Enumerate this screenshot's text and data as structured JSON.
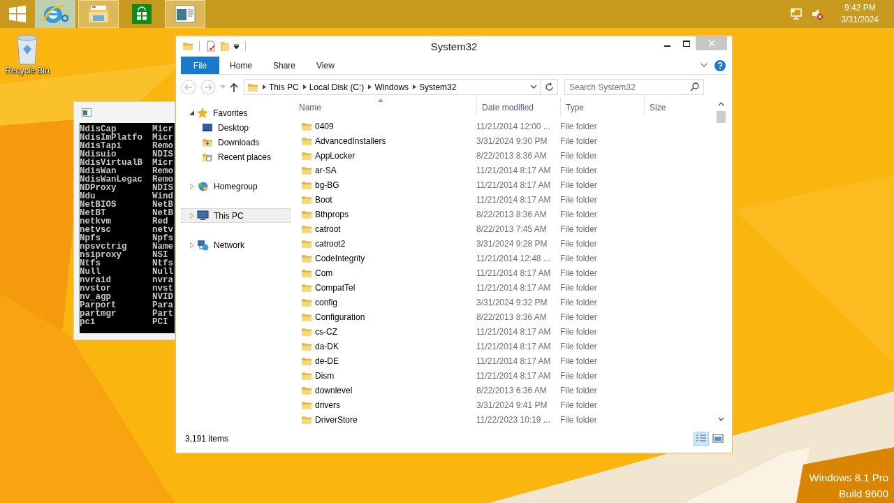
{
  "taskbar": {
    "apps": [
      {
        "kind": "browser",
        "running": false,
        "hovered": true
      },
      {
        "kind": "explorer",
        "running": true,
        "hovered": false
      },
      {
        "kind": "store",
        "running": false,
        "hovered": false
      },
      {
        "kind": "console",
        "running": true,
        "hovered": false
      }
    ],
    "clock": {
      "time": "9:42 PM",
      "date": "3/31/2024"
    }
  },
  "desktop": {
    "icons": [
      {
        "label": "Recycle Bin"
      }
    ],
    "edition": "Windows 8.1 Pro",
    "build": "Build 9600"
  },
  "console": {
    "lines": [
      {
        "col_1": "NdisCap",
        "col_2": "Micr"
      },
      {
        "col_1": "NdisImPlatfo",
        "col_2": "Micr"
      },
      {
        "col_1": "NdisTapi",
        "col_2": "Remo"
      },
      {
        "col_1": "Ndisuio",
        "col_2": "NDIS"
      },
      {
        "col_1": "NdisVirtualB",
        "col_2": "Micr"
      },
      {
        "col_1": "NdisWan",
        "col_2": "Remo"
      },
      {
        "col_1": "NdisWanLegac",
        "col_2": "Remo"
      },
      {
        "col_1": "NDProxy",
        "col_2": "NDIS"
      },
      {
        "col_1": "Ndu",
        "col_2": "Wind"
      },
      {
        "col_1": "NetBIOS",
        "col_2": "NetB"
      },
      {
        "col_1": "NetBT",
        "col_2": "NetB"
      },
      {
        "col_1": "netkvm",
        "col_2": "Red"
      },
      {
        "col_1": "netvsc",
        "col_2": "netv"
      },
      {
        "col_1": "Npfs",
        "col_2": "Npfs"
      },
      {
        "col_1": "npsvctrig",
        "col_2": "Name"
      },
      {
        "col_1": "nsiproxy",
        "col_2": "NSI"
      },
      {
        "col_1": "Ntfs",
        "col_2": "Ntfs"
      },
      {
        "col_1": "Null",
        "col_2": "Null"
      },
      {
        "col_1": "nvraid",
        "col_2": "nvra"
      },
      {
        "col_1": "nvstor",
        "col_2": "nvst"
      },
      {
        "col_1": "nv_agp",
        "col_2": "NVID"
      },
      {
        "col_1": "Parport",
        "col_2": "Para"
      },
      {
        "col_1": "partmgr",
        "col_2": "Part"
      },
      {
        "col_1": "pci",
        "col_2": "PCI"
      }
    ]
  },
  "explorer": {
    "title": "System32",
    "ribbon_tabs": [
      {
        "label": "File",
        "kind": "file"
      },
      {
        "label": "Home",
        "kind": "tab"
      },
      {
        "label": "Share",
        "kind": "tab"
      },
      {
        "label": "View",
        "kind": "tab"
      }
    ],
    "breadcrumb": [
      "This PC",
      "Local Disk (C:)",
      "Windows",
      "System32"
    ],
    "search": {
      "placeholder": "Search System32"
    },
    "nav": [
      {
        "label": "Favorites",
        "kind": "favorites",
        "expanded": true,
        "selected": false,
        "children": [
          {
            "label": "Desktop",
            "kind": "desktop",
            "selected": false
          },
          {
            "label": "Downloads",
            "kind": "downloads",
            "selected": false
          },
          {
            "label": "Recent places",
            "kind": "recent",
            "selected": false
          }
        ]
      },
      {
        "label": "Homegroup",
        "kind": "homegroup",
        "expanded": false,
        "selected": false
      },
      {
        "label": "This PC",
        "kind": "pc",
        "expanded": false,
        "selected": true
      },
      {
        "label": "Network",
        "kind": "network",
        "expanded": false,
        "selected": false
      }
    ],
    "columns": [
      {
        "label": "Name",
        "sorted": true
      },
      {
        "label": "Date modified",
        "sorted": false
      },
      {
        "label": "Type",
        "sorted": false
      },
      {
        "label": "Size",
        "sorted": false
      }
    ],
    "rows": [
      {
        "name": "0409",
        "date": "11/21/2014 12:00 ...",
        "type": "File folder"
      },
      {
        "name": "AdvancedInstallers",
        "date": "3/31/2024 9:30 PM",
        "type": "File folder"
      },
      {
        "name": "AppLocker",
        "date": "8/22/2013 8:36 AM",
        "type": "File folder"
      },
      {
        "name": "ar-SA",
        "date": "11/21/2014 8:17 AM",
        "type": "File folder"
      },
      {
        "name": "bg-BG",
        "date": "11/21/2014 8:17 AM",
        "type": "File folder"
      },
      {
        "name": "Boot",
        "date": "11/21/2014 8:17 AM",
        "type": "File folder"
      },
      {
        "name": "Bthprops",
        "date": "8/22/2013 8:36 AM",
        "type": "File folder"
      },
      {
        "name": "catroot",
        "date": "8/22/2013 7:45 AM",
        "type": "File folder"
      },
      {
        "name": "catroot2",
        "date": "3/31/2024 9:28 PM",
        "type": "File folder"
      },
      {
        "name": "CodeIntegrity",
        "date": "11/21/2014 12:48 ...",
        "type": "File folder"
      },
      {
        "name": "Com",
        "date": "11/21/2014 8:17 AM",
        "type": "File folder"
      },
      {
        "name": "CompatTel",
        "date": "11/21/2014 8:17 AM",
        "type": "File folder"
      },
      {
        "name": "config",
        "date": "3/31/2024 9:32 PM",
        "type": "File folder"
      },
      {
        "name": "Configuration",
        "date": "8/22/2013 8:36 AM",
        "type": "File folder"
      },
      {
        "name": "cs-CZ",
        "date": "11/21/2014 8:17 AM",
        "type": "File folder"
      },
      {
        "name": "da-DK",
        "date": "11/21/2014 8:17 AM",
        "type": "File folder"
      },
      {
        "name": "de-DE",
        "date": "11/21/2014 8:17 AM",
        "type": "File folder"
      },
      {
        "name": "Dism",
        "date": "11/21/2014 8:17 AM",
        "type": "File folder"
      },
      {
        "name": "downlevel",
        "date": "8/22/2013 6:36 AM",
        "type": "File folder"
      },
      {
        "name": "drivers",
        "date": "3/31/2024 9:41 PM",
        "type": "File folder"
      },
      {
        "name": "DriverStore",
        "date": "11/22/2023 10:19 ...",
        "type": "File folder"
      }
    ],
    "status": "3,191 items",
    "view_buttons": [
      {
        "kind": "details",
        "selected": true
      },
      {
        "kind": "large_icons",
        "selected": false
      }
    ]
  }
}
